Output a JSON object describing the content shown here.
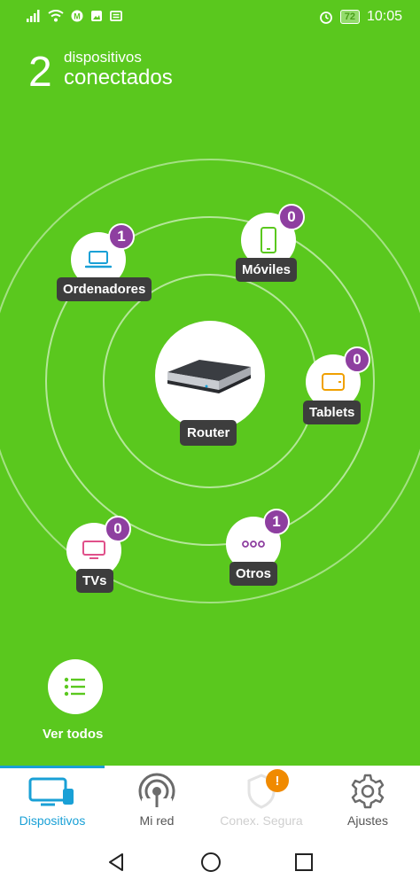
{
  "status_bar": {
    "battery": "72",
    "time": "10:05"
  },
  "header": {
    "count": "2",
    "line1": "dispositivos",
    "line2": "conectados"
  },
  "devices": [
    {
      "label": "Ordenadores",
      "badge": "1",
      "icon": "laptop-icon",
      "color": "#19a0d6"
    },
    {
      "label": "Móviles",
      "badge": "0",
      "icon": "smartphone-icon",
      "color": "#5ac81e"
    },
    {
      "label": "Tablets",
      "badge": "0",
      "icon": "tablet-icon",
      "color": "#f0a000"
    },
    {
      "label": "TVs",
      "badge": "0",
      "icon": "tv-icon",
      "color": "#e0508a"
    },
    {
      "label": "Otros",
      "badge": "1",
      "icon": "more-icon",
      "color": "#8e3fa0"
    }
  ],
  "router": {
    "label": "Router"
  },
  "ver_todos": {
    "label": "Ver todos"
  },
  "bottom_nav": [
    {
      "label": "Dispositivos",
      "active": true,
      "icon": "devices-icon"
    },
    {
      "label": "Mi red",
      "active": false,
      "icon": "network-icon"
    },
    {
      "label": "Conex. Segura",
      "active": false,
      "disabled": true,
      "icon": "shield-icon"
    },
    {
      "label": "Ajustes",
      "active": false,
      "icon": "gear-icon"
    }
  ],
  "warning_badge": "!",
  "colors": {
    "background": "#5ac81e",
    "badge": "#8e3fa0",
    "label_bg": "#3d3d3d",
    "accent": "#19a0d6",
    "warning": "#f08a00"
  }
}
